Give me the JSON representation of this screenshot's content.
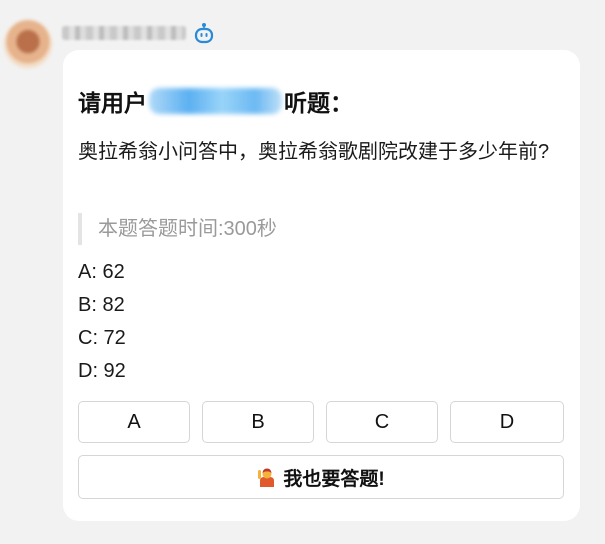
{
  "message": {
    "sender": {
      "name": ""
    },
    "card": {
      "title_prefix": "请用户",
      "title_suffix": "听题：",
      "question": "奥拉希翁小问答中，奥拉希翁歌剧院改建于多少年前?",
      "time_note": "本题答题时间:300秒",
      "options": [
        {
          "label": "A: 62"
        },
        {
          "label": "B: 82"
        },
        {
          "label": "C: 72"
        },
        {
          "label": "D: 92"
        }
      ],
      "answer_buttons": [
        "A",
        "B",
        "C",
        "D"
      ],
      "join_button": "我也要答题!"
    }
  },
  "colors": {
    "background": "#f2f2f2",
    "card": "#ffffff",
    "bot_icon": "#2b8ad8",
    "note_text": "#9a9a9a"
  },
  "icons": {
    "bot": "robot-icon",
    "join": "raising-hand-emoji-icon"
  }
}
